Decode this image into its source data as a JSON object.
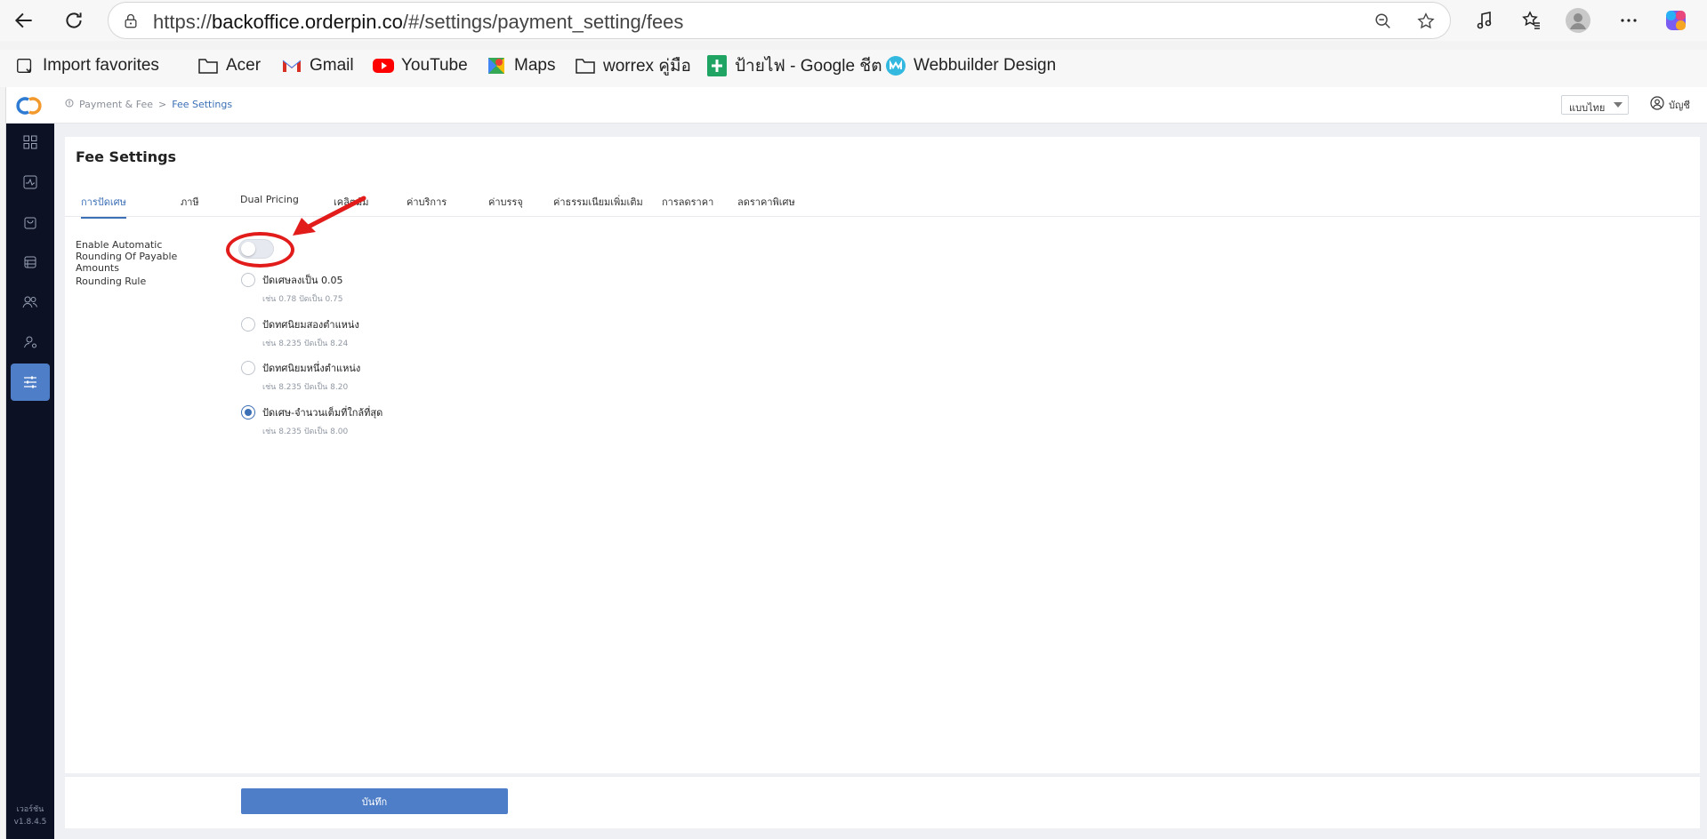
{
  "browser": {
    "url_prefix": "https://",
    "url_host": "backoffice.orderpin.co",
    "url_path": "/#/settings/payment_setting/fees",
    "bookmarks": [
      "Import favorites",
      "Acer",
      "Gmail",
      "YouTube",
      "Maps",
      "worrex คู่มือ",
      "ป้ายไฟ - Google ชีต",
      "Webbuilder Design"
    ]
  },
  "header": {
    "breadcrumb_parent": "Payment & Fee",
    "breadcrumb_separator": ">",
    "breadcrumb_current": "Fee Settings",
    "language": "แบบไทย",
    "account_label": "บัญชี"
  },
  "sidebar": {
    "version_label": "เวอร์ชัน",
    "version": "v1.8.4.5"
  },
  "page": {
    "title": "Fee Settings",
    "tabs": [
      "การปัดเศษ",
      "ภาษี",
      "Dual Pricing",
      "เคลิตมัม",
      "ค่าบริการ",
      "ค่าบรรจุ",
      "ค่าธรรมเนียมเพิ่มเติม",
      "การลดราคา",
      "ลดราคาพิเศษ"
    ],
    "active_tab": "การปัดเศษ",
    "auto_rounding_label": "Enable Automatic Rounding Of Payable Amounts",
    "auto_rounding_enabled": false,
    "rounding_rule_label": "Rounding Rule",
    "options": [
      {
        "label": "ปัดเศษลงเป็น 0.05",
        "hint": "เช่น 0.78 ปัดเป็น 0.75",
        "checked": false
      },
      {
        "label": "ปัดทศนิยมสองตำแหน่ง",
        "hint": "เช่น 8.235 ปัดเป็น 8.24",
        "checked": false
      },
      {
        "label": "ปัดทศนิยมหนึ่งตำแหน่ง",
        "hint": "เช่น 8.235 ปัดเป็น 8.20",
        "checked": false
      },
      {
        "label": "ปัดเศษ-จำนวนเต็มที่ใกล้ที่สุด",
        "hint": "เช่น 8.235 ปัดเป็น 8.00",
        "checked": true
      }
    ],
    "save_label": "บันทึก"
  },
  "colors": {
    "accent": "#3b6fb6",
    "sidebar_bg": "#0c1124",
    "annotation_red": "#e21b1b"
  }
}
